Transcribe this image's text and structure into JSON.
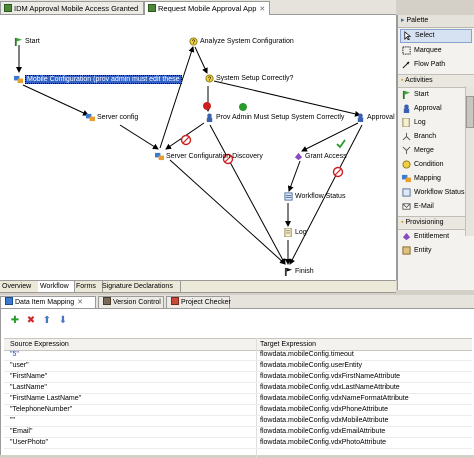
{
  "editor_tabs": [
    {
      "label": "IDM Approval Mobile Access Granted",
      "active": false
    },
    {
      "label": "Request Mobile Approval App",
      "active": true
    }
  ],
  "close_glyph": "✕",
  "canvas_nodes": {
    "start": "Start",
    "analyze": "Analyze System Configuration",
    "mobile_config": "Mobile Configuration (prov admin must edit these",
    "system_setup": "System Setup Correctly?",
    "prov_admin": "Prov Admin Must Setup System Correctly",
    "approval": "Approval",
    "server_config": "Server config",
    "server_discovery": "Server Configuration Discovery",
    "grant_access": "Grant Access",
    "workflow_status": "Workflow Status",
    "log": "Log",
    "finish": "Finish"
  },
  "palette": {
    "title": "Palette",
    "tools": [
      {
        "label": "Select",
        "selected": true,
        "icon": "select-arrow-icon"
      },
      {
        "label": "Marquee",
        "selected": false,
        "icon": "marquee-icon"
      },
      {
        "label": "Flow Path",
        "selected": false,
        "icon": "flow-path-icon"
      }
    ],
    "activities_title": "Activities",
    "activities": [
      {
        "label": "Start",
        "icon": "start-icon"
      },
      {
        "label": "Approval",
        "icon": "approval-icon"
      },
      {
        "label": "Log",
        "icon": "log-icon"
      },
      {
        "label": "Branch",
        "icon": "branch-icon"
      },
      {
        "label": "Merge",
        "icon": "merge-icon"
      },
      {
        "label": "Condition",
        "icon": "condition-icon"
      },
      {
        "label": "Mapping",
        "icon": "mapping-icon"
      },
      {
        "label": "Workflow Status",
        "icon": "workflow-status-icon"
      },
      {
        "label": "E-Mail",
        "icon": "email-icon"
      }
    ],
    "provisioning_title": "Provisioning",
    "provisioning": [
      {
        "label": "Entitlement",
        "icon": "entitlement-icon"
      },
      {
        "label": "Entity",
        "icon": "entity-icon"
      }
    ]
  },
  "bottom_tabs": [
    "Overview",
    "Workflow",
    "Forms",
    "Signature Declarations"
  ],
  "panel_tabs": [
    {
      "label": "Data Item Mapping",
      "active": true
    },
    {
      "label": "Version Control",
      "active": false
    },
    {
      "label": "Project Checker",
      "active": false
    }
  ],
  "toolbar": {
    "add": "✚",
    "remove": "✖",
    "up": "⬆",
    "down": "⬇"
  },
  "table": {
    "headers": [
      "Source Expression",
      "Target Expression"
    ],
    "rows": [
      {
        "source": "\"5\"",
        "target": "flowdata.mobileConfig.timeout"
      },
      {
        "source": "\"user\"",
        "target": "flowdata.mobileConfig.userEntity"
      },
      {
        "source": "\"FirstName\"",
        "target": "flowdata.mobileConfig.vdxFirstNameAttribute"
      },
      {
        "source": "\"LastName\"",
        "target": "flowdata.mobileConfig.vdxLastNameAttribute"
      },
      {
        "source": "\"FirstName LastName\"",
        "target": "flowdata.mobileConfig.vdxNameFormatAttribute"
      },
      {
        "source": "\"TelephoneNumber\"",
        "target": "flowdata.mobileConfig.vdxPhoneAttribute"
      },
      {
        "source": "\"\"",
        "target": "flowdata.mobileConfig.vdxMobileAttribute"
      },
      {
        "source": "\"Email\"",
        "target": "flowdata.mobileConfig.vdxEmailAttribute"
      },
      {
        "source": "\"UserPhoto\"",
        "target": "flowdata.mobileConfig.vdxPhotoAttribute"
      }
    ]
  },
  "colors": {
    "selection": "#3062c8",
    "flow_line": "#000000",
    "deny": "#cc1f1f",
    "accept": "#2a9a2a"
  }
}
